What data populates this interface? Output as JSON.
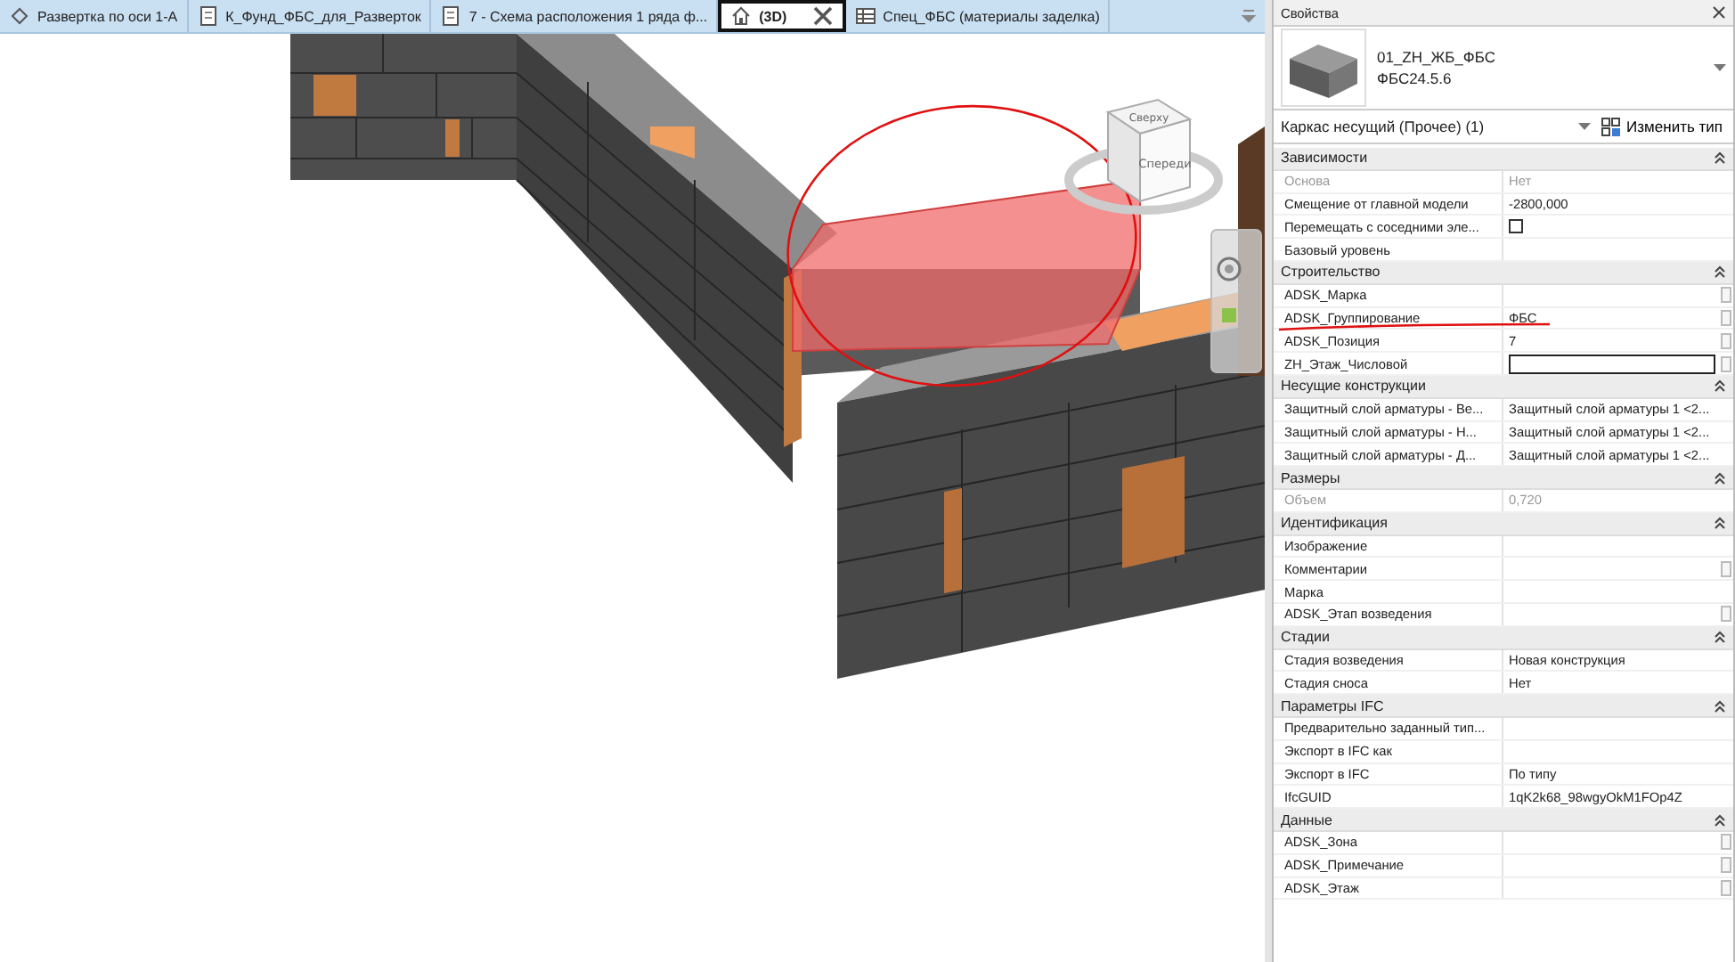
{
  "tabs": [
    {
      "label": "Развертка по оси 1-А",
      "kind": "elevation",
      "selected": false
    },
    {
      "label": "К_Фунд_ФБС_для_Разверток",
      "kind": "sheet",
      "selected": false
    },
    {
      "label": "7 - Схема расположения 1 ряда ф...",
      "kind": "sheet",
      "selected": false
    },
    {
      "label": "(3D)",
      "kind": "house",
      "selected": true
    },
    {
      "label": "Спец_ФБС (материалы заделка)",
      "kind": "schedule",
      "selected": false
    }
  ],
  "viewcube": {
    "top": "Сверху",
    "front": "Спереди"
  },
  "properties": {
    "title": "Свойства",
    "type": {
      "family": "01_ZH_ЖБ_ФБС",
      "name": "ФБС24.5.6"
    },
    "selector": {
      "category": "Каркас несущий (Прочее) (1)",
      "edit_type": "Изменить тип"
    },
    "groups": [
      {
        "name": "Зависимости",
        "rows": [
          {
            "label": "Основа",
            "kind": "text",
            "value": "Нет",
            "disabled": true,
            "param_button": false
          },
          {
            "label": "Смещение от главной модели",
            "kind": "text",
            "value": "-2800,000",
            "disabled": false,
            "param_button": false
          },
          {
            "label": "Перемещать с соседними эле...",
            "kind": "checkbox",
            "checked": false,
            "disabled": false,
            "param_button": false
          },
          {
            "label": "Базовый уровень",
            "kind": "text",
            "disabled": false,
            "param_button": false
          }
        ]
      },
      {
        "name": "Строительство",
        "rows": [
          {
            "label": "ADSK_Марка",
            "kind": "text",
            "disabled": false,
            "param_button": true
          },
          {
            "label": "ADSK_Группирование",
            "kind": "text",
            "value": "ФБС",
            "disabled": false,
            "param_button": true
          },
          {
            "label": "ADSK_Позиция",
            "kind": "text",
            "value": "7",
            "disabled": false,
            "param_button": true
          },
          {
            "label": "ZH_Этаж_Числовой",
            "kind": "field",
            "disabled": false,
            "param_button": true
          }
        ]
      },
      {
        "name": "Несущие конструкции",
        "rows": [
          {
            "label": "Защитный слой арматуры - Ве...",
            "kind": "text",
            "value": "Защитный слой арматуры 1 <2...",
            "disabled": false,
            "param_button": false
          },
          {
            "label": "Защитный слой арматуры - Н...",
            "kind": "text",
            "value": "Защитный слой арматуры 1 <2...",
            "disabled": false,
            "param_button": false
          },
          {
            "label": "Защитный слой арматуры - Д...",
            "kind": "text",
            "value": "Защитный слой арматуры 1 <2...",
            "disabled": false,
            "param_button": false
          }
        ]
      },
      {
        "name": "Размеры",
        "rows": [
          {
            "label": "Объем",
            "kind": "text",
            "value": "0,720",
            "disabled": true,
            "param_button": false
          }
        ]
      },
      {
        "name": "Идентификация",
        "rows": [
          {
            "label": "Изображение",
            "kind": "text",
            "disabled": false,
            "param_button": false
          },
          {
            "label": "Комментарии",
            "kind": "text",
            "disabled": false,
            "param_button": true
          },
          {
            "label": "Марка",
            "kind": "text",
            "disabled": false,
            "param_button": false
          },
          {
            "label": "ADSK_Этап возведения",
            "kind": "text",
            "disabled": false,
            "param_button": true
          }
        ]
      },
      {
        "name": "Стадии",
        "rows": [
          {
            "label": "Стадия возведения",
            "kind": "text",
            "value": "Новая конструкция",
            "disabled": false,
            "param_button": false
          },
          {
            "label": "Стадия сноса",
            "kind": "text",
            "value": "Нет",
            "disabled": false,
            "param_button": false
          }
        ]
      },
      {
        "name": "Параметры IFC",
        "rows": [
          {
            "label": "Предварительно заданный тип...",
            "kind": "text",
            "disabled": false,
            "param_button": false
          },
          {
            "label": "Экспорт в IFC как",
            "kind": "text",
            "disabled": false,
            "param_button": false
          },
          {
            "label": "Экспорт в IFC",
            "kind": "text",
            "value": "По типу",
            "disabled": false,
            "param_button": false
          },
          {
            "label": "IfcGUID",
            "kind": "text",
            "value": "1qK2k68_98wgyOkM1FOp4Z",
            "disabled": false,
            "param_button": false
          }
        ]
      },
      {
        "name": "Данные",
        "rows": [
          {
            "label": "ADSK_Зона",
            "kind": "text",
            "disabled": false,
            "param_button": true
          },
          {
            "label": "ADSK_Примечание",
            "kind": "text",
            "disabled": false,
            "param_button": true
          },
          {
            "label": "ADSK_Этаж",
            "kind": "text",
            "disabled": false,
            "param_button": true
          }
        ]
      }
    ]
  }
}
